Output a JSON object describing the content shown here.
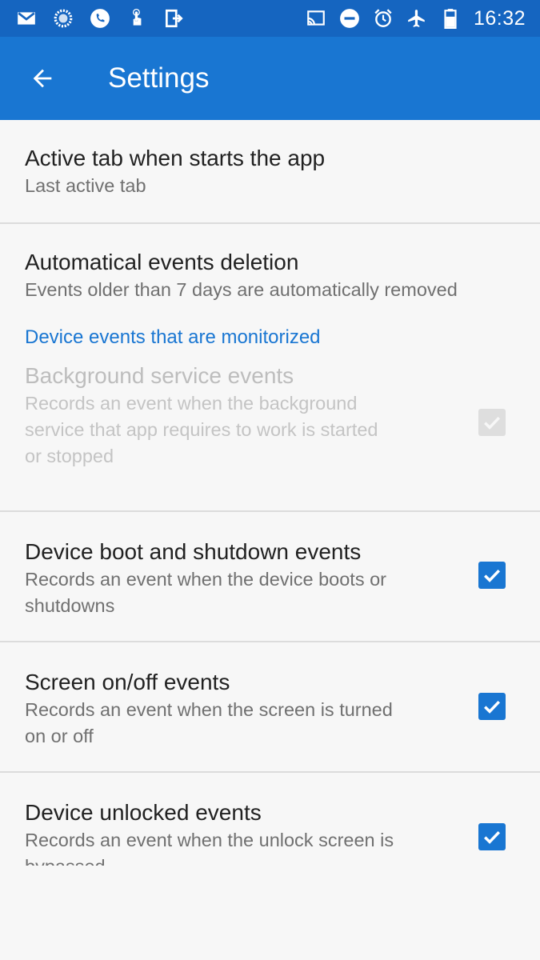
{
  "status_bar": {
    "time": "16:32",
    "left_icons": [
      "gmail-icon",
      "sync-icon",
      "phone-icon",
      "touch-icon",
      "exit-icon"
    ],
    "right_icons": [
      "cast-icon",
      "do-not-disturb-icon",
      "alarm-icon",
      "airplane-mode-icon",
      "battery-icon"
    ]
  },
  "app_bar": {
    "title": "Settings"
  },
  "preferences": {
    "active_tab": {
      "title": "Active tab when starts the app",
      "summary": "Last active tab"
    },
    "auto_deletion": {
      "title": "Automatical events deletion",
      "summary": "Events older than 7 days are automatically removed"
    },
    "category": "Device events that are monitorized",
    "background_service": {
      "title": "Background service events",
      "summary_lines": [
        "Records an event when the background",
        "service that app requires to work is started",
        "or stopped"
      ],
      "checked": true,
      "enabled": false
    },
    "boot_shutdown": {
      "title": "Device boot and shutdown events",
      "summary_lines": [
        "Records an event when the device boots or",
        "shutdowns"
      ],
      "checked": true,
      "enabled": true
    },
    "screen_onoff": {
      "title": "Screen on/off events",
      "summary_lines": [
        "Records an event when the screen is turned",
        "on or off"
      ],
      "checked": true,
      "enabled": true
    },
    "unlocked": {
      "title": "Device unlocked events",
      "summary_lines": [
        "Records an event when the unlock screen is",
        "bypassed"
      ],
      "checked": true,
      "enabled": true
    }
  },
  "colors": {
    "status_bar": "#1565c0",
    "app_bar": "#1976d2",
    "accent": "#1976d2",
    "background": "#f7f7f7"
  }
}
